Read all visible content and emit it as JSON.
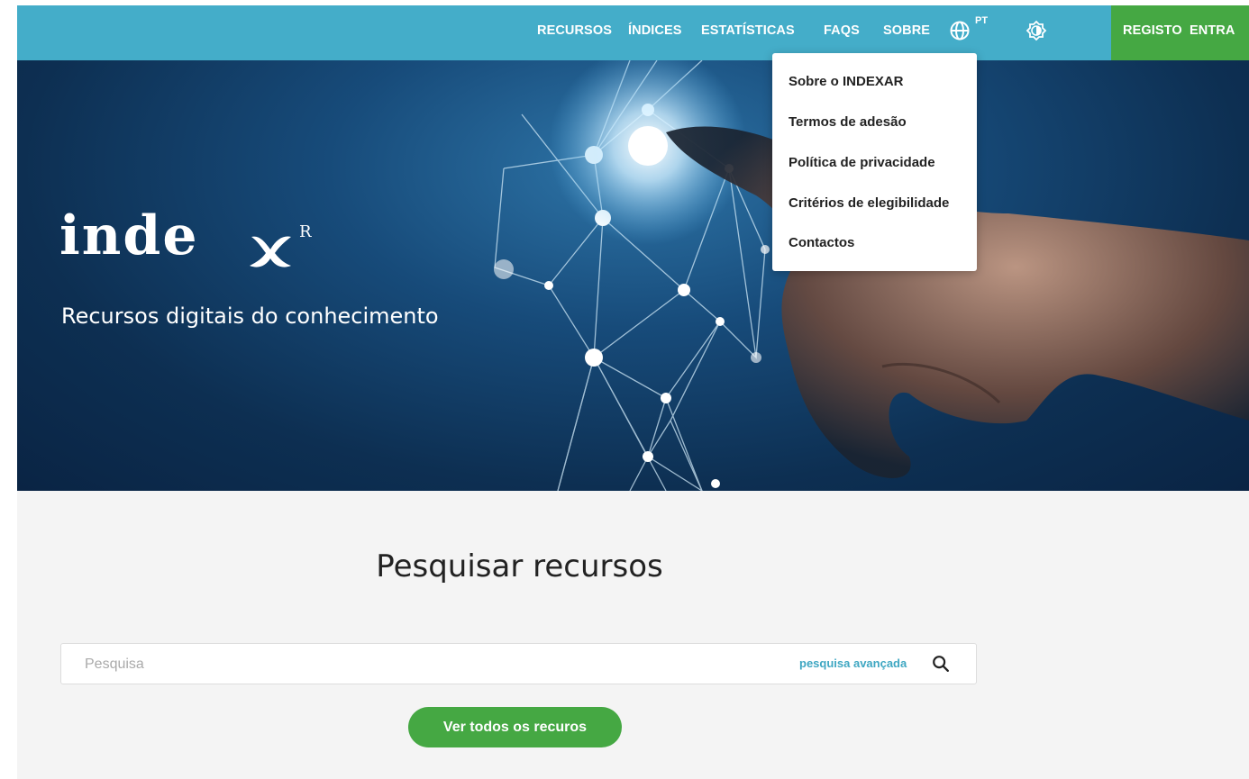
{
  "nav": {
    "items": [
      "RECURSOS",
      "ÍNDICES",
      "ESTATÍSTICAS",
      "FAQS",
      "SOBRE"
    ],
    "language": "PT",
    "register": "REGISTO",
    "login": "ENTRA"
  },
  "hero": {
    "logo": "inde",
    "logo_sup": "R",
    "tagline": "Recursos digitais do conhecimento"
  },
  "dropdown": {
    "items": [
      "Sobre o INDEXAR",
      "Termos de adesão",
      "Política de privacidade",
      "Critérios de elegibilidade",
      "Contactos"
    ]
  },
  "search": {
    "title": "Pesquisar recursos",
    "placeholder": "Pesquisa",
    "advanced": "pesquisa avançada",
    "view_all": "Ver todos os recuros"
  },
  "colors": {
    "nav_bg": "#44adc9",
    "accent_green": "#45a843",
    "link": "#3fa7c2"
  }
}
